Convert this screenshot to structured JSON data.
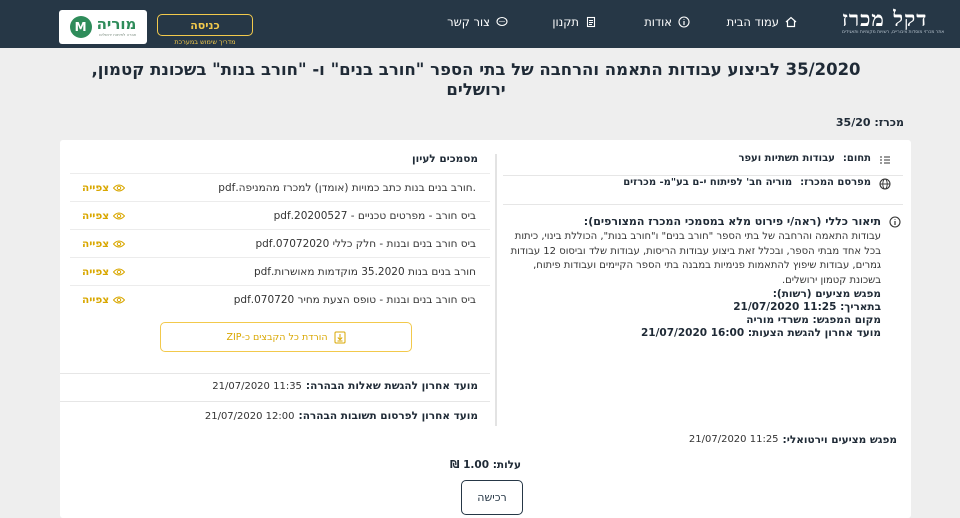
{
  "header": {
    "brand_name": "דקל מכרז",
    "brand_sub": "אתר מכרזי מוסדות ציבוריים, רשויות מקומיות ותאגידים",
    "nav": [
      {
        "label": "עמוד הבית",
        "icon": "home-icon"
      },
      {
        "label": "אודות",
        "icon": "info-icon"
      },
      {
        "label": "תקנון",
        "icon": "document-icon"
      },
      {
        "label": "צור קשר",
        "icon": "chat-icon"
      }
    ],
    "login_label": "כניסה",
    "login_sub": "מדריך שימוש במערכת",
    "moria_name": "מוריה",
    "moria_badge": "M",
    "moria_tag": "חברה לפיתוח ירושלים"
  },
  "page": {
    "title": "35/2020 לביצוע עבודות התאמה והרחבה של בתי הספר \"חורב בנים\" ו- \"חורב בנות\" בשכונת קטמון, ירושלים",
    "tender_label": "מכרז:",
    "tender_number": "35/20"
  },
  "details": {
    "field_label": "תחום:",
    "field_value": "עבודות תשתיות ועפר",
    "publisher_label": "מפרסם המכרז:",
    "publisher_value": "מוריה חב' לפיתוח י-ם בע\"מ- מכרזים",
    "desc_title": "תיאור כללי (ראה/י פירוט מלא במסמכי המכרז המצורפים):",
    "desc_text": "עבודות התאמה והרחבה של בתי הספר \"חורב בנים\" ו\"חורב בנות\", הכוללת בינוי, כיתות בכל אחד מבתי הספר, ובכלל זאת ביצוע עבודות הריסות, עבודות שלד וביסוס 12 עבודות גמרים, עבודות שיפוץ להתאמות פנימיות במבנה בתי הספר הקיימים ועבודות פיתוח, בשכונת קטמון ירושלים.",
    "meet_title": "מפגש מציעים (רשות):",
    "meet_date": "בתאריך: 11:25 21/07/2020",
    "meet_place": "מקום המפגש: משרדי מוריה",
    "deadline": "מועד אחרון להגשת הצעות: 16:00 21/07/2020"
  },
  "documents": {
    "heading": "מסמכים לעיון",
    "view_label": "צפייה",
    "items": [
      {
        "name": ".חורב בנים בנות כתב כמויות (אומדן) למכרז מהמניפה.pdf"
      },
      {
        "name": "ביס חורב - מפרטים טכניים - 20200527.pdf"
      },
      {
        "name": "ביס חורב בנים ובנות - חלק כללי 07072020.pdf"
      },
      {
        "name": "חורב בנים בנות 35.2020 מוקדמות מאושרות.pdf"
      },
      {
        "name": "ביס חורב בנים ובנות - טופס הצעת מחיר 070720.pdf"
      }
    ],
    "zip_label": "הורדת כל הקבצים כ-ZIP"
  },
  "deadlines": {
    "questions_label": "מועד אחרון להגשת שאלות הבהרה:",
    "questions_value": "11:35 21/07/2020",
    "answers_label": "מועד אחרון לפרסום תשובות הבהרה:",
    "answers_value": "12:00 21/07/2020",
    "virtual_label": "מפגש מציעים וירטואלי:",
    "virtual_value": "11:25 21/07/2020"
  },
  "purchase": {
    "cost": "עלות: 1.00 ₪",
    "buy_label": "רכישה"
  },
  "colors": {
    "navbar": "#263746",
    "accent": "#f2c94c",
    "view_link": "#d9a700",
    "moria_green": "#2e8c5a"
  }
}
